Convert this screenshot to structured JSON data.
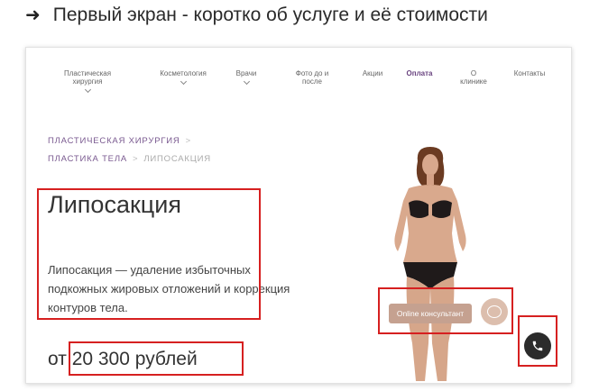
{
  "heading": {
    "arrow_icon": "right-arrow-icon",
    "text": "Первый экран - коротко об услуге и её стоимости"
  },
  "nav": {
    "items": [
      {
        "label": "Пластическая\nхирургия",
        "dropdown": true
      },
      {
        "label": "Косметология",
        "dropdown": true
      },
      {
        "label": "Врачи",
        "dropdown": true
      },
      {
        "label": "Фото до и\nпосле",
        "dropdown": false
      },
      {
        "label": "Акции",
        "dropdown": false
      },
      {
        "label": "Оплата",
        "dropdown": false,
        "active": true
      },
      {
        "label": "О\nклинике",
        "dropdown": false
      },
      {
        "label": "Контакты",
        "dropdown": false
      }
    ]
  },
  "breadcrumbs": {
    "level1": "ПЛАСТИЧЕСКАЯ ХИРУРГИЯ",
    "level2": "ПЛАСТИКА ТЕЛА",
    "current": "ЛИПОСАКЦИЯ",
    "separator": ">"
  },
  "page": {
    "title": "Липосакция",
    "description": "Липосакция — удаление избыточных подкожных жировых отложений и коррекция контуров тела.",
    "price_prefix": "от",
    "price_value": "20 300 рублей"
  },
  "widgets": {
    "consultant_label": "Online консультант",
    "phone_icon": "phone-icon"
  },
  "colors": {
    "accent": "#6a4480",
    "consult_bg": "#c5a190",
    "highlight": "#d62020",
    "call_button": "#2b2b2b"
  }
}
